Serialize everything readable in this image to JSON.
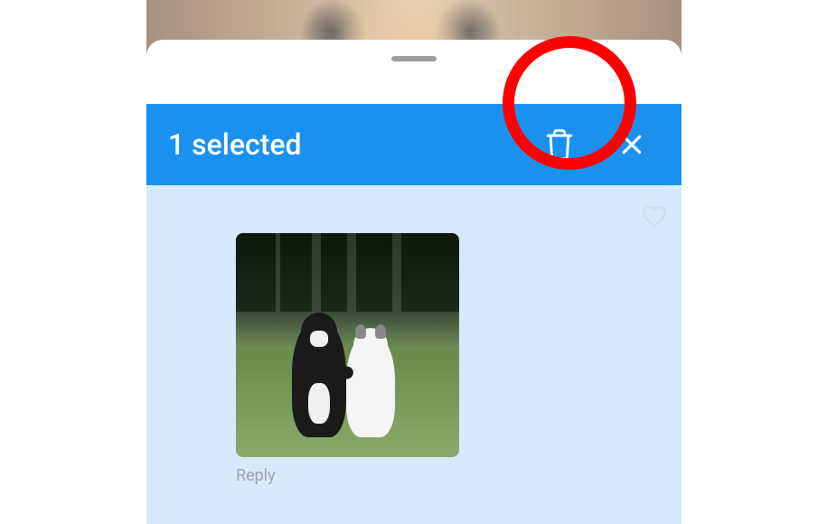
{
  "selection": {
    "count_label": "1 selected"
  },
  "actions": {
    "delete": "Delete",
    "close": "Close"
  },
  "message": {
    "reply_label": "Reply",
    "attachment_alt": "Two dogs sitting on grass"
  },
  "annotation": {
    "highlight": "delete-button"
  },
  "colors": {
    "selection_bar": "#1b91ef",
    "chat_bg": "#d6eafc",
    "annotation_circle": "#ff0000"
  }
}
